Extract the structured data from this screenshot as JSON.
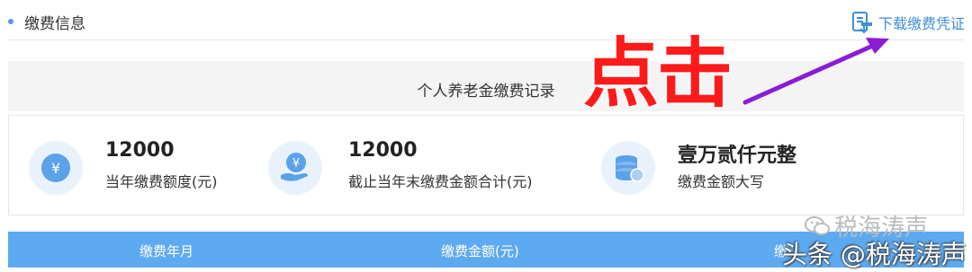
{
  "section": {
    "title": "缴费信息"
  },
  "download": {
    "label": "下载缴费凭证",
    "icon": "document-download-icon"
  },
  "record": {
    "title": "个人养老金缴费记录"
  },
  "stats": [
    {
      "value": "12000",
      "label": "当年缴费额度(元)",
      "icon": "yen-coin-icon"
    },
    {
      "value": "12000",
      "label": "截止当年末缴费金额合计(元)",
      "icon": "hand-yen-icon"
    },
    {
      "value": "壹万贰仟元整",
      "label": "缴费金额大写",
      "icon": "coin-stack-icon"
    }
  ],
  "table": {
    "columns": [
      "缴费年月",
      "缴费金额(元)",
      "缴"
    ]
  },
  "overlay": {
    "click_text": "点击"
  },
  "watermarks": {
    "wechat": "税海涛声",
    "toutiao": "头条 @税海涛声"
  },
  "colors": {
    "accent_blue": "#3d8fd8",
    "table_header": "#5eaaf0",
    "annotation_red": "#ff1a1a",
    "annotation_arrow": "#8a1bd6"
  }
}
